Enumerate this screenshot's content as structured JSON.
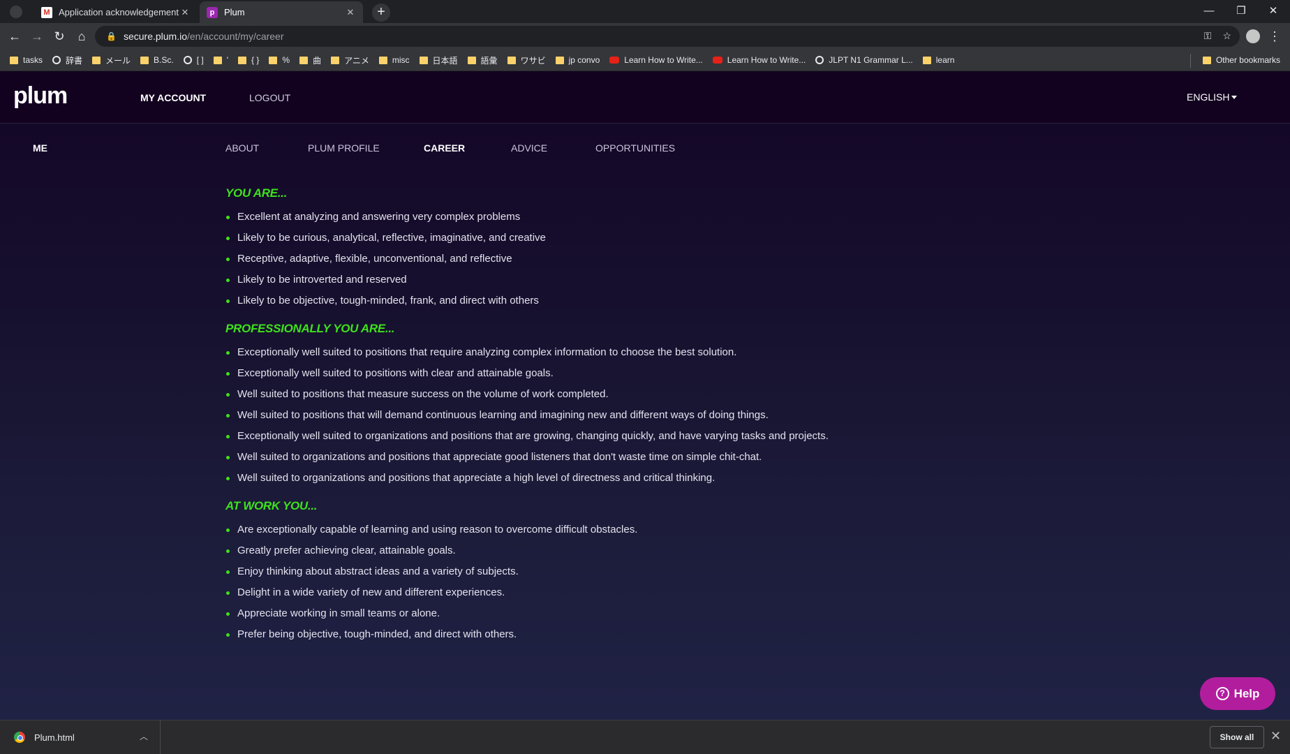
{
  "browser": {
    "tabs": [
      {
        "title": "Application acknowledgement - j",
        "icon": "gmail-icon"
      },
      {
        "title": "Plum",
        "icon": "plum-icon"
      }
    ],
    "url_host": "secure.plum.io",
    "url_path": "/en/account/my/career",
    "bookmarks": [
      {
        "label": "tasks",
        "icon": "folder"
      },
      {
        "label": "辞書",
        "icon": "globe"
      },
      {
        "label": "メール",
        "icon": "folder"
      },
      {
        "label": "B.Sc.",
        "icon": "folder"
      },
      {
        "label": "[ ]",
        "icon": "globe"
      },
      {
        "label": "'",
        "icon": "folder"
      },
      {
        "label": "{ }",
        "icon": "folder"
      },
      {
        "label": "%",
        "icon": "folder"
      },
      {
        "label": "曲",
        "icon": "folder"
      },
      {
        "label": "アニメ",
        "icon": "folder"
      },
      {
        "label": "misc",
        "icon": "folder"
      },
      {
        "label": "日本語",
        "icon": "folder"
      },
      {
        "label": "語彙",
        "icon": "folder"
      },
      {
        "label": "ワサビ",
        "icon": "folder"
      },
      {
        "label": "jp convo",
        "icon": "folder"
      },
      {
        "label": "Learn How to Write...",
        "icon": "youtube"
      },
      {
        "label": "Learn How to Write...",
        "icon": "youtube"
      },
      {
        "label": "JLPT N1 Grammar L...",
        "icon": "globe"
      },
      {
        "label": "learn",
        "icon": "folder"
      }
    ],
    "other_bookmarks": "Other bookmarks"
  },
  "site": {
    "logo": "plum",
    "header_nav": {
      "my_account": "MY ACCOUNT",
      "logout": "LOGOUT"
    },
    "language": "ENGLISH",
    "subnav": {
      "me": "ME",
      "items": [
        "ABOUT",
        "PLUM PROFILE",
        "CAREER",
        "ADVICE",
        "OPPORTUNITIES"
      ],
      "active": "CAREER"
    },
    "sections": [
      {
        "title": "YOU ARE...",
        "items": [
          "Excellent at analyzing and answering very complex problems",
          "Likely to be curious, analytical, reflective, imaginative, and creative",
          "Receptive, adaptive, flexible, unconventional, and reflective",
          "Likely to be introverted and reserved",
          "Likely to be objective, tough-minded, frank, and direct with others"
        ]
      },
      {
        "title": "PROFESSIONALLY YOU ARE...",
        "items": [
          "Exceptionally well suited to positions that require analyzing complex information to choose the best solution.",
          "Exceptionally well suited to positions with clear and attainable goals.",
          "Well suited to positions that measure success on the volume of work completed.",
          "Well suited to positions that will demand continuous learning and imagining new and different ways of doing things.",
          "Exceptionally well suited to organizations and positions that are growing, changing quickly, and have varying tasks and projects.",
          "Well suited to organizations and positions that appreciate good listeners that don't waste time on simple chit-chat.",
          "Well suited to organizations and positions that appreciate a high level of directness and critical thinking."
        ]
      },
      {
        "title": "AT WORK YOU...",
        "items": [
          "Are exceptionally capable of learning and using reason to overcome difficult obstacles.",
          "Greatly prefer achieving clear, attainable goals.",
          "Enjoy thinking about abstract ideas and a variety of subjects.",
          "Delight in a wide variety of new and different experiences.",
          "Appreciate working in small teams or alone.",
          "Prefer being objective, tough-minded, and direct with others."
        ]
      }
    ],
    "help_label": "Help",
    "accent_color": "#3ee21b",
    "help_color": "#b21d9e"
  },
  "downloads": {
    "file": "Plum.html",
    "show_all": "Show all"
  }
}
